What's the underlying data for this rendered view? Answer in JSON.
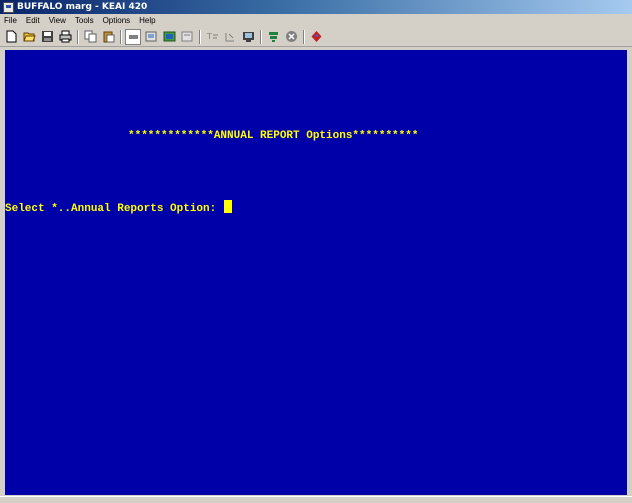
{
  "window": {
    "title": "BUFFALO marg - KEAI 420"
  },
  "menubar": {
    "items": [
      {
        "label": "File"
      },
      {
        "label": "Edit"
      },
      {
        "label": "View"
      },
      {
        "label": "Tools"
      },
      {
        "label": "Options"
      },
      {
        "label": "Help"
      }
    ]
  },
  "toolbar": {
    "icons": [
      "new-icon",
      "open-icon",
      "save-icon",
      "print-icon",
      "copy-icon",
      "paste-icon",
      "connect-icon",
      "send-file-icon",
      "receive-file-icon",
      "capture-icon",
      "font-icon",
      "keyboard-icon",
      "screen-icon",
      "macro-icon",
      "stop-icon",
      "help-icon"
    ]
  },
  "terminal": {
    "background": "#0000a8",
    "foreground": "#ffff00",
    "heading": "*************ANNUAL REPORT Options**********",
    "prompt": "Select *..Annual Reports Option: "
  }
}
